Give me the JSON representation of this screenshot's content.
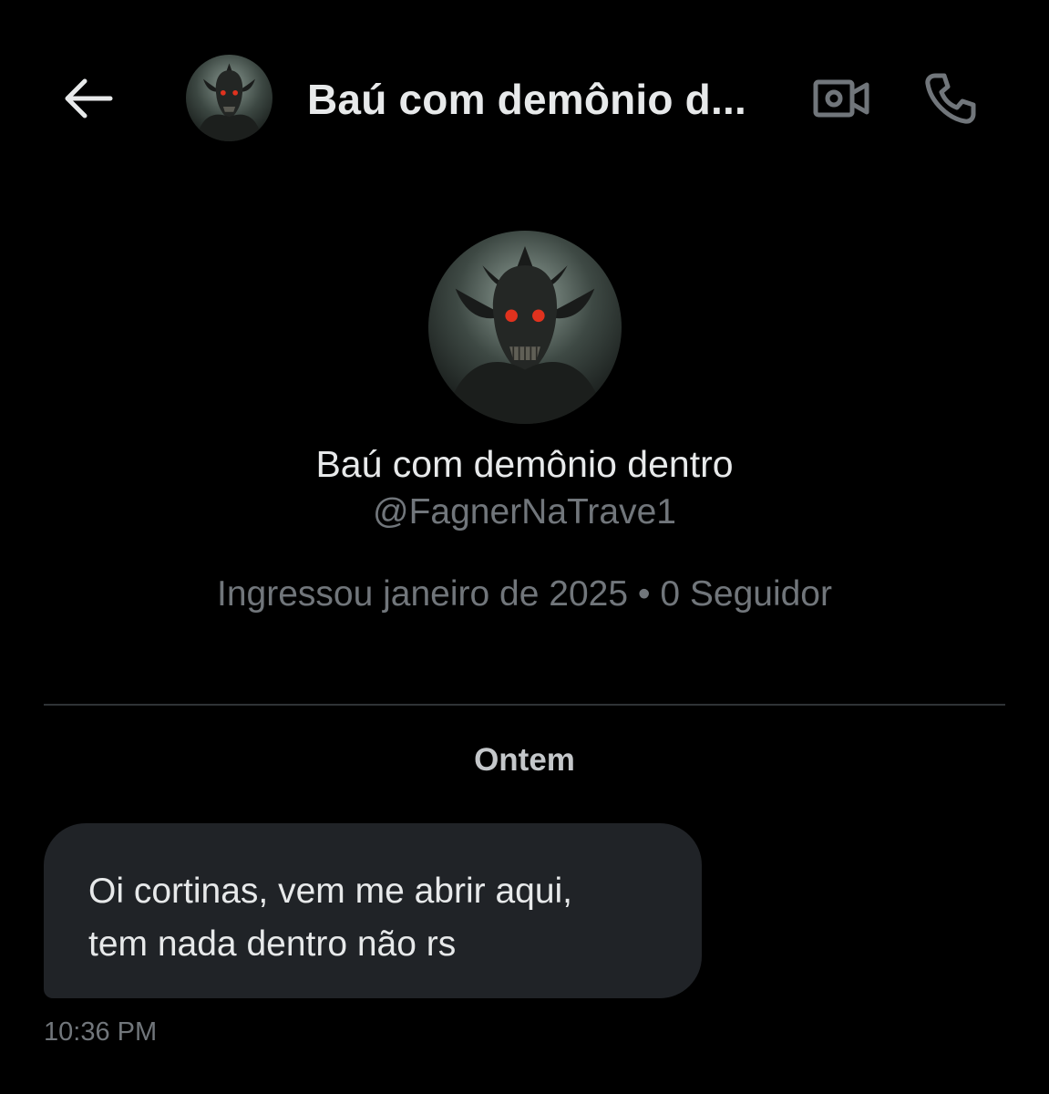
{
  "header": {
    "back_label": "Back",
    "title": "Baú com demônio d...",
    "avatar_icon": "demon-avatar",
    "video_icon": "video-camera-icon",
    "call_icon": "phone-icon"
  },
  "profile": {
    "name": "Baú com demônio dentro",
    "handle": "@FagnerNaTrave1",
    "meta": "Ingressou janeiro de 2025 • 0 Seguidor"
  },
  "conversation": {
    "date_separator": "Ontem",
    "messages": [
      {
        "text": "Oi cortinas, vem me abrir aqui,\ntem nada dentro não rs",
        "time": "10:36 PM"
      }
    ]
  },
  "colors": {
    "background": "#000000",
    "text_primary": "#e7e9ea",
    "text_secondary": "#71767b",
    "bubble": "#202327",
    "divider": "#2f3336",
    "demon_eyes": "#e0321e"
  }
}
